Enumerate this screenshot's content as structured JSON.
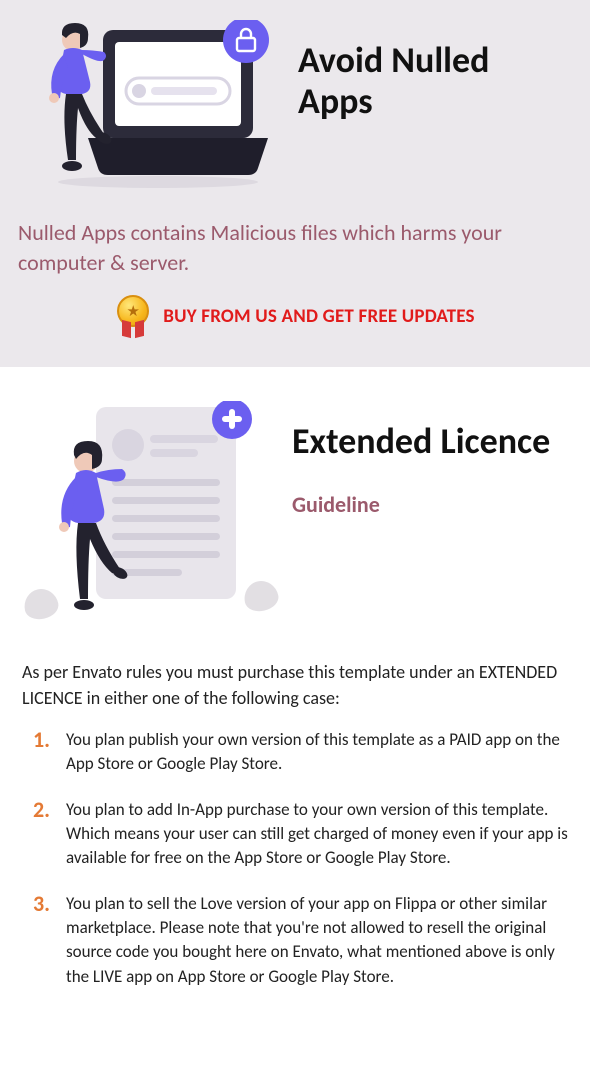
{
  "section1": {
    "title": "Avoid Nulled Apps",
    "subtitle": "Nulled Apps contains Malicious files which harms your computer & server.",
    "cta": "BUY FROM US AND GET FREE UPDATES"
  },
  "section2": {
    "title": "Extended Licence",
    "subtitle": "Guideline",
    "intro": "As per Envato rules you must purchase this template under an EXTENDED LICENCE in either one of the following case:",
    "items": [
      {
        "num": "1.",
        "text": "You plan publish your own version of this template as a PAID app on the App Store or Google Play Store."
      },
      {
        "num": "2.",
        "text": "You plan to add In-App purchase to your own version of this template. Which means your user can still get charged of money even if your app is available for free on the App Store or Google Play Store."
      },
      {
        "num": "3.",
        "text": "You plan to sell the Love version of your app on Flippa or other similar marketplace. Please note that you're not allowed to resell the original source code you bought here on Envato, what mentioned above is only the LIVE app on App Store or Google Play Store."
      }
    ]
  }
}
